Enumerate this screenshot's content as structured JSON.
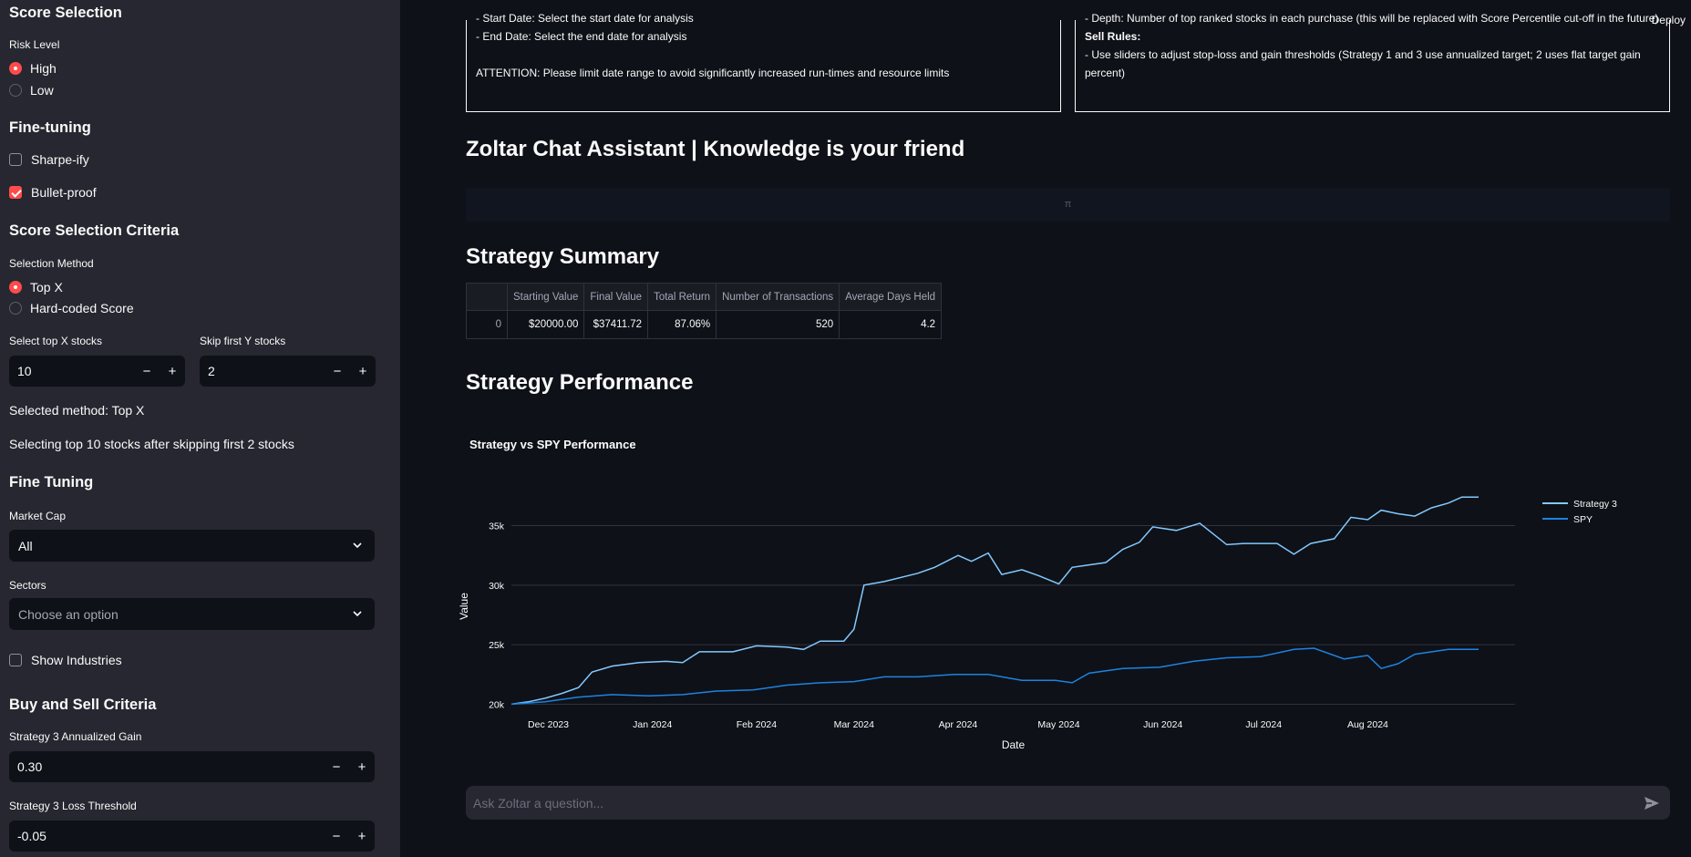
{
  "sidebar": {
    "score_selection_title": "Score Selection",
    "risk_level_label": "Risk Level",
    "risk_options": [
      "High",
      "Low"
    ],
    "fine_tuning_title": "Fine-tuning",
    "sharpe_label": "Sharpe-ify",
    "bullet_label": "Bullet-proof",
    "criteria_title": "Score Selection Criteria",
    "selection_method_label": "Selection Method",
    "method_options": [
      "Top X",
      "Hard-coded Score"
    ],
    "top_x_label": "Select top X stocks",
    "top_x_value": "10",
    "skip_y_label": "Skip first Y stocks",
    "skip_y_value": "2",
    "selected_method_text": "Selected method: Top X",
    "selecting_text": "Selecting top 10 stocks after skipping first 2 stocks",
    "fine_tuning2_title": "Fine Tuning",
    "market_cap_label": "Market Cap",
    "market_cap_value": "All",
    "sectors_label": "Sectors",
    "sectors_placeholder": "Choose an option",
    "show_industries_label": "Show Industries",
    "buy_sell_title": "Buy and Sell Criteria",
    "annualized_gain_label": "Strategy 3 Annualized Gain",
    "annualized_gain_value": "0.30",
    "loss_threshold_label": "Strategy 3 Loss Threshold",
    "loss_threshold_value": "-0.05",
    "minus": "−",
    "plus": "+"
  },
  "header": {
    "deploy": "Deploy"
  },
  "info_left": {
    "lines": [
      "- Start Date: Select the start date for analysis",
      "- End Date: Select the end date for analysis",
      "",
      "ATTENTION: Please limit date range to avoid significantly increased run-times and resource limits"
    ]
  },
  "info_right": {
    "line1": "- Depth: Number of top ranked stocks in each purchase (this will be replaced with Score Percentile cut-off in the future)",
    "sell_rules": "Sell Rules:",
    "line2": "- Use sliders to adjust stop-loss and gain thresholds (Strategy 1 and 3 use annualized target; 2 uses flat target gain",
    "line3": "percent)"
  },
  "chat_title": "Zoltar Chat Assistant | Knowledge is your friend",
  "chat_output_glyph": "π",
  "summary_title": "Strategy Summary",
  "summary_table": {
    "headers": [
      "",
      "Starting Value",
      "Final Value",
      "Total Return",
      "Number of Transactions",
      "Average Days Held"
    ],
    "row": [
      "0",
      "$20000.00",
      "$37411.72",
      "87.06%",
      "520",
      "4.2"
    ]
  },
  "performance_title": "Strategy Performance",
  "chat_input_placeholder": "Ask Zoltar a question...",
  "colors": {
    "strategy": "#83c9ff",
    "spy": "#1c83e1",
    "accent": "#ff4b4b"
  },
  "chart_data": {
    "type": "line",
    "title": "Strategy vs SPY Performance",
    "xlabel": "Date",
    "ylabel": "Value",
    "x_range": [
      "2023-11-20",
      "2024-09-03"
    ],
    "ylim": [
      19800,
      37800
    ],
    "y_ticks": [
      20000,
      25000,
      30000,
      35000
    ],
    "y_tick_labels": [
      "20k",
      "25k",
      "30k",
      "35k"
    ],
    "x_ticks": [
      "2023-12-01",
      "2024-01-01",
      "2024-02-01",
      "2024-03-01",
      "2024-04-01",
      "2024-05-01",
      "2024-06-01",
      "2024-07-01",
      "2024-08-01"
    ],
    "x_tick_labels": [
      "Dec 2023",
      "Jan 2024",
      "Feb 2024",
      "Mar 2024",
      "Apr 2024",
      "May 2024",
      "Jun 2024",
      "Jul 2024",
      "Aug 2024"
    ],
    "legend_position": "top-right",
    "grid": true,
    "series": [
      {
        "name": "Strategy 3",
        "points": [
          [
            "2023-11-20",
            20000
          ],
          [
            "2023-11-25",
            20200
          ],
          [
            "2023-11-30",
            20500
          ],
          [
            "2023-12-05",
            20900
          ],
          [
            "2023-12-10",
            21400
          ],
          [
            "2023-12-14",
            22700
          ],
          [
            "2023-12-20",
            23200
          ],
          [
            "2023-12-28",
            23500
          ],
          [
            "2024-01-05",
            23600
          ],
          [
            "2024-01-10",
            23500
          ],
          [
            "2024-01-15",
            24400
          ],
          [
            "2024-01-25",
            24400
          ],
          [
            "2024-02-01",
            24900
          ],
          [
            "2024-02-10",
            24800
          ],
          [
            "2024-02-15",
            24600
          ],
          [
            "2024-02-20",
            25300
          ],
          [
            "2024-02-27",
            25300
          ],
          [
            "2024-03-01",
            26300
          ],
          [
            "2024-03-04",
            30000
          ],
          [
            "2024-03-10",
            30300
          ],
          [
            "2024-03-20",
            31000
          ],
          [
            "2024-03-25",
            31500
          ],
          [
            "2024-04-01",
            32500
          ],
          [
            "2024-04-05",
            32000
          ],
          [
            "2024-04-10",
            32700
          ],
          [
            "2024-04-14",
            30900
          ],
          [
            "2024-04-20",
            31300
          ],
          [
            "2024-04-25",
            30800
          ],
          [
            "2024-05-01",
            30100
          ],
          [
            "2024-05-05",
            31500
          ],
          [
            "2024-05-10",
            31700
          ],
          [
            "2024-05-15",
            31900
          ],
          [
            "2024-05-20",
            33000
          ],
          [
            "2024-05-25",
            33600
          ],
          [
            "2024-05-29",
            34900
          ],
          [
            "2024-06-05",
            34600
          ],
          [
            "2024-06-12",
            35200
          ],
          [
            "2024-06-20",
            33400
          ],
          [
            "2024-06-25",
            33500
          ],
          [
            "2024-07-05",
            33500
          ],
          [
            "2024-07-10",
            32600
          ],
          [
            "2024-07-15",
            33500
          ],
          [
            "2024-07-22",
            33900
          ],
          [
            "2024-07-27",
            35700
          ],
          [
            "2024-08-01",
            35500
          ],
          [
            "2024-08-05",
            36300
          ],
          [
            "2024-08-10",
            36000
          ],
          [
            "2024-08-15",
            35800
          ],
          [
            "2024-08-20",
            36500
          ],
          [
            "2024-08-25",
            36900
          ],
          [
            "2024-08-29",
            37400
          ],
          [
            "2024-09-03",
            37400
          ]
        ]
      },
      {
        "name": "SPY",
        "points": [
          [
            "2023-11-20",
            20000
          ],
          [
            "2023-11-30",
            20200
          ],
          [
            "2023-12-10",
            20600
          ],
          [
            "2023-12-20",
            20800
          ],
          [
            "2023-12-31",
            20700
          ],
          [
            "2024-01-10",
            20800
          ],
          [
            "2024-01-20",
            21100
          ],
          [
            "2024-01-31",
            21200
          ],
          [
            "2024-02-10",
            21600
          ],
          [
            "2024-02-20",
            21800
          ],
          [
            "2024-03-01",
            21900
          ],
          [
            "2024-03-10",
            22300
          ],
          [
            "2024-03-20",
            22300
          ],
          [
            "2024-03-31",
            22500
          ],
          [
            "2024-04-10",
            22500
          ],
          [
            "2024-04-20",
            22000
          ],
          [
            "2024-04-30",
            22000
          ],
          [
            "2024-05-05",
            21800
          ],
          [
            "2024-05-10",
            22600
          ],
          [
            "2024-05-20",
            23000
          ],
          [
            "2024-05-31",
            23100
          ],
          [
            "2024-06-10",
            23600
          ],
          [
            "2024-06-20",
            23900
          ],
          [
            "2024-06-30",
            24000
          ],
          [
            "2024-07-10",
            24600
          ],
          [
            "2024-07-16",
            24700
          ],
          [
            "2024-07-25",
            23800
          ],
          [
            "2024-08-01",
            24100
          ],
          [
            "2024-08-05",
            23000
          ],
          [
            "2024-08-10",
            23400
          ],
          [
            "2024-08-15",
            24200
          ],
          [
            "2024-08-25",
            24600
          ],
          [
            "2024-09-03",
            24600
          ]
        ]
      }
    ]
  }
}
